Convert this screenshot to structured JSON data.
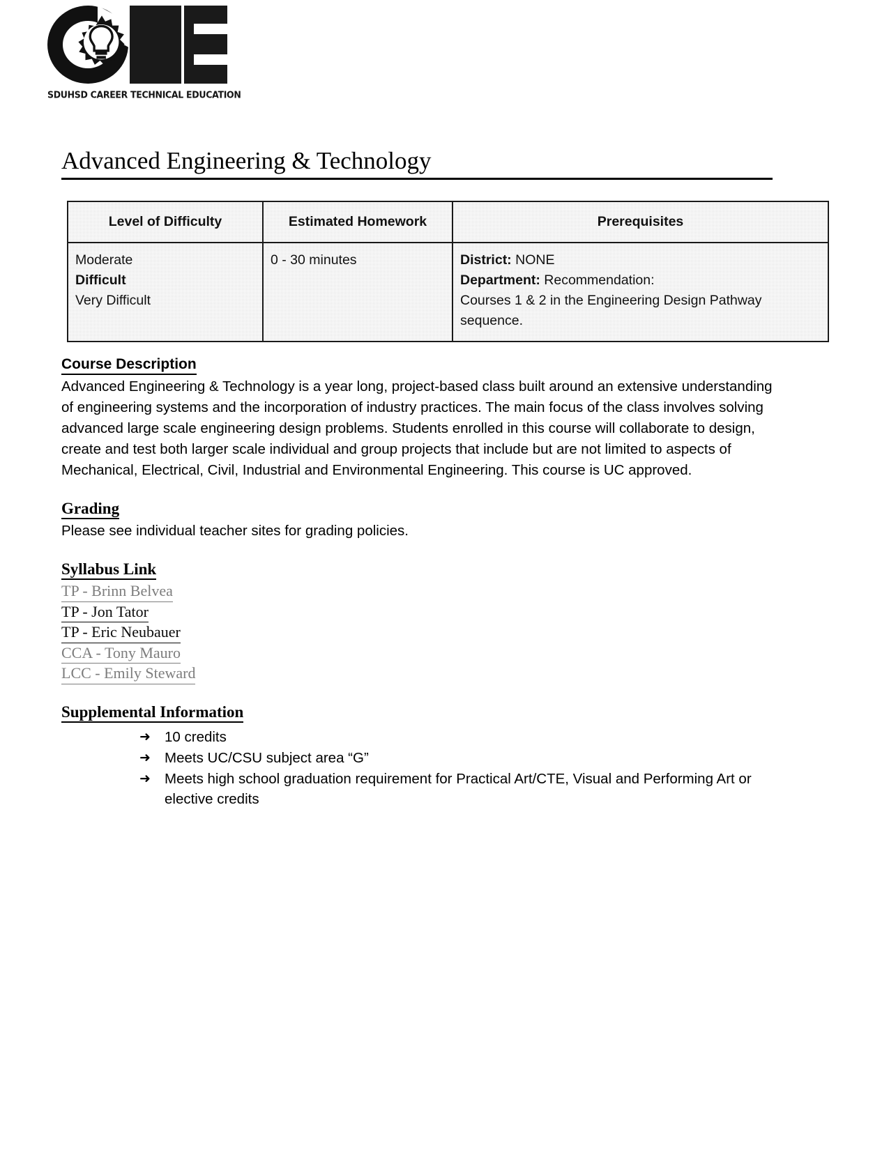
{
  "logo": {
    "mark_letters": "CTE",
    "caption": "SDUHSD CAREER TECHNICAL EDUCATION"
  },
  "page_title": "Advanced Engineering & Technology",
  "info_table": {
    "headers": [
      "Level of Difficulty",
      "Estimated Homework",
      "Prerequisites"
    ],
    "difficulty_levels": [
      "Moderate",
      "Difficult",
      "Very Difficult"
    ],
    "difficulty_selected": "Difficult",
    "homework": "0 - 30 minutes",
    "prerequisites": {
      "district_label": "District:",
      "district_value": "NONE",
      "department_label": "Department:",
      "department_value": "Recommendation:",
      "department_detail": "Courses 1 & 2 in the Engineering Design Pathway sequence."
    }
  },
  "course_description": {
    "heading": "Course Description",
    "body": "Advanced Engineering & Technology is a year long, project-based class built around an extensive understanding of engineering systems and the incorporation of industry practices. The main focus of the class involves solving advanced large scale engineering design problems. Students enrolled in this course will collaborate to design, create and test both larger scale individual and group projects that include but are not limited to aspects of Mechanical, Electrical, Civil, Industrial and Environmental Engineering. This course is UC approved."
  },
  "grading": {
    "heading": "Grading",
    "body": "Please see individual teacher sites for grading policies."
  },
  "syllabus": {
    "heading": "Syllabus Link",
    "links": [
      {
        "label": "TP - Brinn Belvea",
        "state": "faded"
      },
      {
        "label": "TP - Jon Tator",
        "state": "solid"
      },
      {
        "label": "TP - Eric Neubauer",
        "state": "solid"
      },
      {
        "label": "CCA - Tony Mauro",
        "state": "faded"
      },
      {
        "label": "LCC - Emily Steward",
        "state": "faded"
      }
    ]
  },
  "supplemental": {
    "heading": "Supplemental Information",
    "bullet_icon": "arrow-right-icon",
    "items": [
      "10 credits",
      "Meets UC/CSU subject area “G”",
      "Meets high school graduation requirement for Practical Art/CTE, Visual and Performing Art or elective credits"
    ]
  }
}
